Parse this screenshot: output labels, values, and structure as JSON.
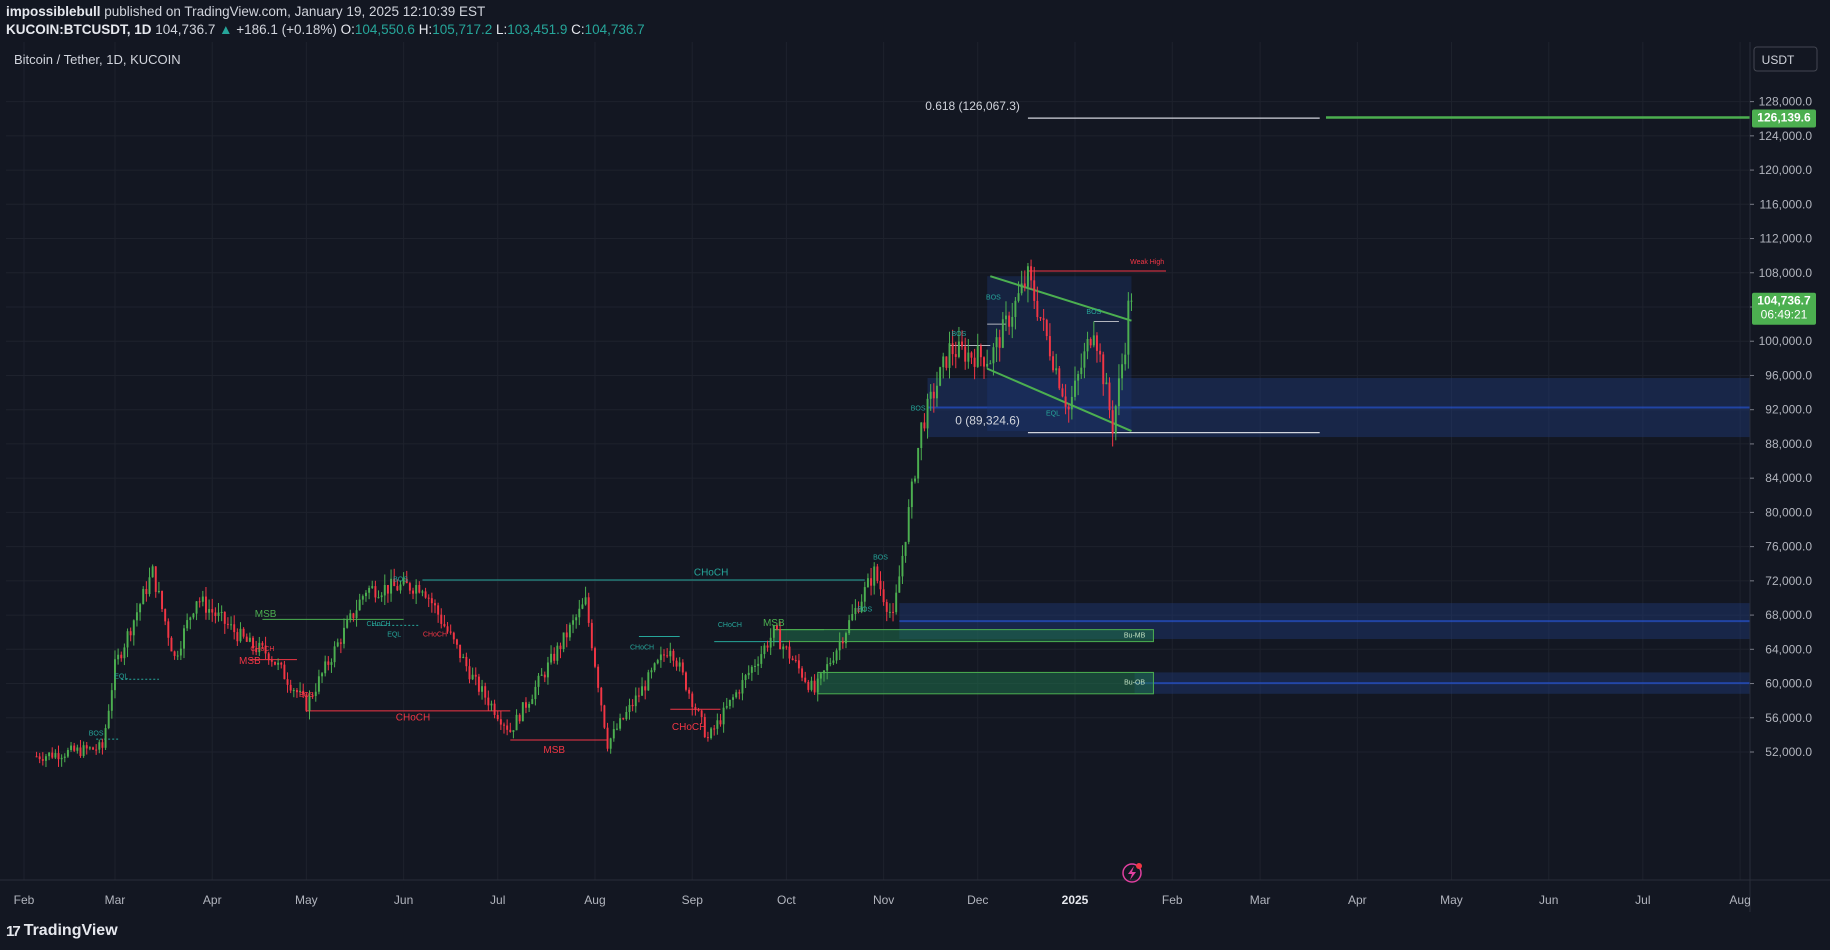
{
  "header": {
    "author": "impossiblebull",
    "published": "published on TradingView.com, January 19, 2025 12:10:39 EST",
    "symbol": "KUCOIN:BTCUSDT, 1D",
    "last": "104,736.7",
    "change_arrow": "▲",
    "change": "+186.1 (+0.18%)",
    "o_label": "O:",
    "o": "104,550.6",
    "h_label": "H:",
    "h": "105,717.2",
    "l_label": "L:",
    "l": "103,451.9",
    "c_label": "C:",
    "c": "104,736.7"
  },
  "chart_title": "Bitcoin / Tether, 1D, KUCOIN",
  "currency_button": "USDT",
  "footer": {
    "brand": "TradingView",
    "brand_icon": "tradingview-logo-icon"
  },
  "colors": {
    "background": "#131722",
    "up": "#4caf50",
    "down": "#f23645",
    "bos_teal": "#26a69a",
    "zone_blue": "#1e3a78",
    "price_label": "#4caf50"
  },
  "chart_data": {
    "type": "candlestick",
    "title": "Bitcoin / Tether, 1D, KUCOIN",
    "x_labels": [
      "Feb",
      "Mar",
      "Apr",
      "May",
      "Jun",
      "Jul",
      "Aug",
      "Sep",
      "Oct",
      "Nov",
      "Dec",
      "2025",
      "Feb",
      "Mar",
      "Apr",
      "May",
      "Jun",
      "Jul",
      "Aug"
    ],
    "y_ticks": [
      52000,
      56000,
      60000,
      64000,
      68000,
      72000,
      76000,
      80000,
      84000,
      88000,
      92000,
      96000,
      100000,
      104000,
      108000,
      112000,
      116000,
      120000,
      124000,
      128000
    ],
    "y_tick_labels": [
      "52,000.0",
      "56,000.0",
      "60,000.0",
      "64,000.0",
      "68,000.0",
      "72,000.0",
      "76,000.0",
      "80,000.0",
      "84,000.0",
      "88,000.0",
      "92,000.0",
      "96,000.0",
      "100,000.0",
      "104,000.0",
      "108,000.0",
      "112,000.0",
      "116,000.0",
      "120,000.0",
      "124,000.0",
      "128,000.0"
    ],
    "ylim": [
      51000,
      130000
    ],
    "price_path_approx": [
      {
        "date": "2024-02-05",
        "price": 51500
      },
      {
        "date": "2024-02-26",
        "price": 52500
      },
      {
        "date": "2024-03-01",
        "price": 62000
      },
      {
        "date": "2024-03-13",
        "price": 73000
      },
      {
        "date": "2024-03-20",
        "price": 63000
      },
      {
        "date": "2024-03-27",
        "price": 70000
      },
      {
        "date": "2024-04-13",
        "price": 64500
      },
      {
        "date": "2024-04-19",
        "price": 63500
      },
      {
        "date": "2024-05-01",
        "price": 57500
      },
      {
        "date": "2024-05-20",
        "price": 71000
      },
      {
        "date": "2024-06-07",
        "price": 71500
      },
      {
        "date": "2024-06-24",
        "price": 60000
      },
      {
        "date": "2024-07-05",
        "price": 54500
      },
      {
        "date": "2024-07-29",
        "price": 69500
      },
      {
        "date": "2024-08-05",
        "price": 53000
      },
      {
        "date": "2024-08-25",
        "price": 64500
      },
      {
        "date": "2024-09-06",
        "price": 53500
      },
      {
        "date": "2024-09-27",
        "price": 66000
      },
      {
        "date": "2024-10-10",
        "price": 59000
      },
      {
        "date": "2024-10-29",
        "price": 73000
      },
      {
        "date": "2024-11-04",
        "price": 67500
      },
      {
        "date": "2024-11-13",
        "price": 90000
      },
      {
        "date": "2024-11-22",
        "price": 99000
      },
      {
        "date": "2024-12-05",
        "price": 98000
      },
      {
        "date": "2024-12-17",
        "price": 107500
      },
      {
        "date": "2024-12-30",
        "price": 92000
      },
      {
        "date": "2025-01-07",
        "price": 102000
      },
      {
        "date": "2025-01-13",
        "price": 90000
      },
      {
        "date": "2025-01-19",
        "price": 104736.7
      }
    ],
    "last_price": "104,736.7",
    "countdown": "06:49:21",
    "alert_price": "126,139.6",
    "fib_levels": [
      {
        "label": "0.618 (126,067.3)",
        "price": 126067.3
      },
      {
        "label": "0 (89,324.6)",
        "price": 89324.6
      }
    ],
    "annotations": [
      {
        "text": "CHoCH",
        "color": "#26a69a",
        "date": "2024-09-07",
        "price": 72600
      },
      {
        "text": "MSB",
        "color": "#4caf50",
        "date": "2024-04-18",
        "price": 67800
      },
      {
        "text": "MSB",
        "color": "#4caf50",
        "date": "2024-09-27",
        "price": 66700
      },
      {
        "text": "MSB",
        "color": "#f23645",
        "date": "2024-04-13",
        "price": 62300
      },
      {
        "text": "MSB",
        "color": "#f23645",
        "date": "2024-07-19",
        "price": 51900
      },
      {
        "text": "CHoCH",
        "color": "#f23645",
        "date": "2024-06-04",
        "price": 55700
      },
      {
        "text": "EQL",
        "color": "#26a69a",
        "date": "2024-03-03",
        "price": 60600
      },
      {
        "text": "EQL",
        "color": "#26a69a",
        "date": "2024-05-29",
        "price": 65500
      },
      {
        "text": "BOS",
        "color": "#26a69a",
        "date": "2024-02-24",
        "price": 53900
      },
      {
        "text": "BOS",
        "color": "#26a69a",
        "date": "2024-05-31",
        "price": 71900
      },
      {
        "text": "BOS",
        "color": "#26a69a",
        "date": "2024-10-26",
        "price": 68400
      },
      {
        "text": "BOS",
        "color": "#26a69a",
        "date": "2024-10-31",
        "price": 74500
      },
      {
        "text": "BOS",
        "color": "#26a69a",
        "date": "2024-11-12",
        "price": 91900
      },
      {
        "text": "BOS",
        "color": "#26a69a",
        "date": "2024-11-25",
        "price": 100600
      },
      {
        "text": "BOS",
        "color": "#26a69a",
        "date": "2024-12-06",
        "price": 104900
      },
      {
        "text": "BOS",
        "color": "#26a69a",
        "date": "2025-01-07",
        "price": 103200
      },
      {
        "text": "BOS",
        "color": "#f23645",
        "date": "2024-05-01",
        "price": 58400
      },
      {
        "text": "CHoCH",
        "color": "#26a69a",
        "date": "2024-05-24",
        "price": 66700
      },
      {
        "text": "CHoCH",
        "color": "#f23645",
        "date": "2024-06-11",
        "price": 65500
      },
      {
        "text": "CHoCH",
        "color": "#f23645",
        "date": "2024-04-17",
        "price": 63800
      },
      {
        "text": "CHoCH",
        "color": "#26a69a",
        "date": "2024-08-16",
        "price": 64000
      },
      {
        "text": "CHoCH",
        "color": "#26a69a",
        "date": "2024-09-13",
        "price": 66600
      },
      {
        "text": "CHoCH",
        "color": "#f23645",
        "date": "2024-08-31",
        "price": 54600
      },
      {
        "text": "EQL",
        "color": "#26a69a",
        "date": "2024-12-25",
        "price": 91300
      },
      {
        "text": "Weak High",
        "color": "#f23645",
        "date": "2025-01-24",
        "price": 109000
      },
      {
        "text": "Bu-MB",
        "color": "#c0e0c0",
        "date": "2025-01-20",
        "price": 65400
      },
      {
        "text": "Bu-OB",
        "color": "#c0e0c0",
        "date": "2025-01-20",
        "price": 59900
      }
    ],
    "zones": [
      {
        "kind": "demand",
        "color": "#1e3a78",
        "from_date": "2024-11-15",
        "to": "right-edge",
        "price_low": 88800,
        "price_high": 95700
      },
      {
        "kind": "demand",
        "color": "#1e3a78",
        "from_date": "2024-11-06",
        "to": "right-edge",
        "price_low": 65200,
        "price_high": 69400
      },
      {
        "kind": "demand",
        "color": "#1e3a78",
        "from_date": "2025-01-20",
        "to": "right-edge",
        "price_low": 58800,
        "price_high": 61300
      },
      {
        "kind": "Bu-MB",
        "color": "#1f6f4a",
        "from_date": "2024-09-27",
        "to_date": "2025-01-26",
        "price_low": 64900,
        "price_high": 66300
      },
      {
        "kind": "Bu-OB",
        "color": "#1f6f4a",
        "from_date": "2024-10-11",
        "to_date": "2025-01-26",
        "price_low": 58800,
        "price_high": 61300
      }
    ],
    "channel": [
      {
        "from": {
          "date": "2024-12-05",
          "price": 107600
        },
        "to": {
          "date": "2025-01-19",
          "price": 102400
        }
      },
      {
        "from": {
          "date": "2024-12-04",
          "price": 96800
        },
        "to": {
          "date": "2025-01-19",
          "price": 89500
        }
      }
    ],
    "grid": true,
    "legend": "none"
  }
}
